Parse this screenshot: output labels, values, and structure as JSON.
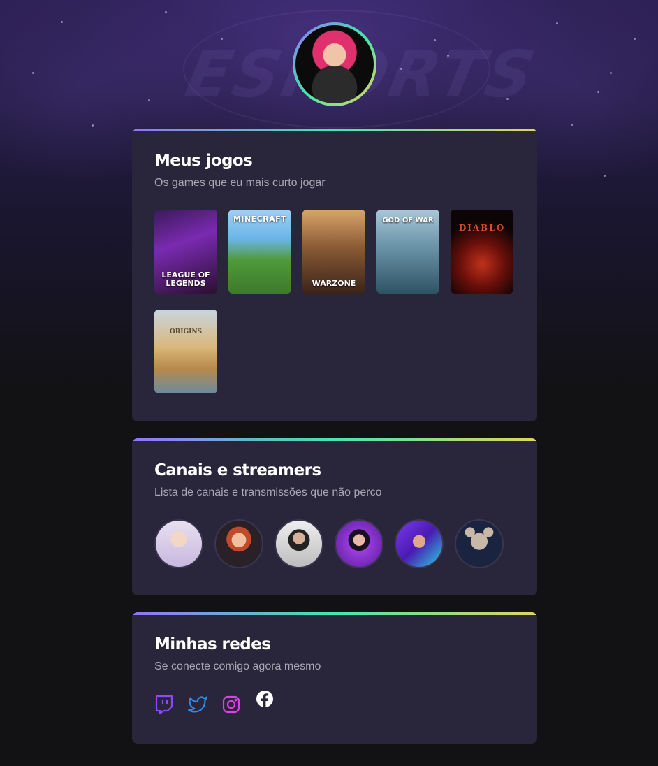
{
  "background": {
    "watermark_text": "ESPORTS"
  },
  "profile": {
    "avatar_icon": "profile-avatar"
  },
  "games_section": {
    "title": "Meus jogos",
    "subtitle": "Os games que eu mais curto jogar",
    "games": [
      {
        "name": "League of Legends",
        "cover_text": "LEAGUE OF LEGENDS"
      },
      {
        "name": "Minecraft",
        "cover_text": "MINECRAFT"
      },
      {
        "name": "Call of Duty Warzone",
        "cover_text": "WARZONE"
      },
      {
        "name": "God of War",
        "cover_text": "GOD OF WAR"
      },
      {
        "name": "Diablo III",
        "cover_text": "DIABLO"
      },
      {
        "name": "Assassin's Creed Origins",
        "cover_text": "ORIGINS"
      }
    ]
  },
  "streamers_section": {
    "title": "Canais e streamers",
    "subtitle": "Lista de canais e transmissões que não perco",
    "streamers": [
      {
        "icon": "streamer-avatar-1"
      },
      {
        "icon": "streamer-avatar-2"
      },
      {
        "icon": "streamer-avatar-3"
      },
      {
        "icon": "streamer-avatar-4"
      },
      {
        "icon": "streamer-avatar-5"
      },
      {
        "icon": "streamer-avatar-6"
      }
    ]
  },
  "social_section": {
    "title": "Minhas redes",
    "subtitle": "Se conecte comigo agora mesmo",
    "links": [
      {
        "icon": "twitch-icon",
        "color": "#9146ff"
      },
      {
        "icon": "twitter-icon",
        "color": "#2a8ff0"
      },
      {
        "icon": "instagram-icon",
        "color": "#e03ee8"
      },
      {
        "icon": "facebook-icon",
        "color": "#ffffff"
      }
    ]
  },
  "theme": {
    "gradient": [
      "#9572fc",
      "#43e7ad",
      "#e2d45c"
    ],
    "card_bg": "#29253a",
    "page_bg": "#121214"
  }
}
